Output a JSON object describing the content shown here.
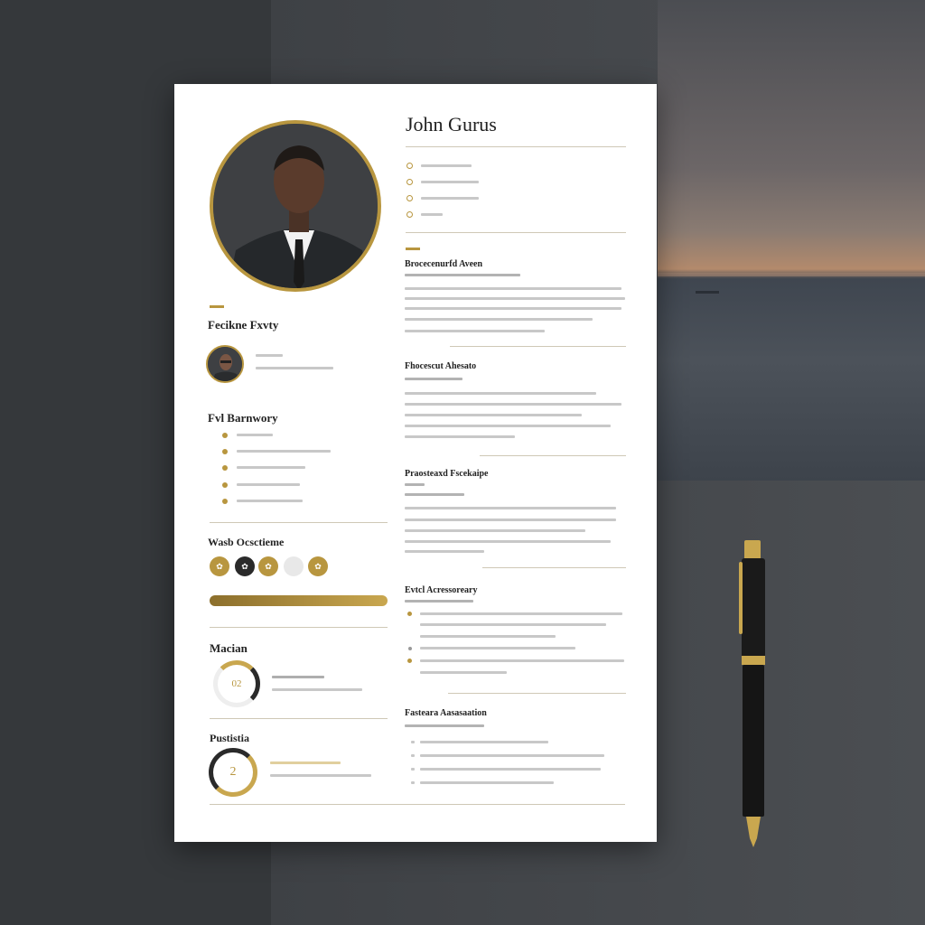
{
  "resume": {
    "name": "John Gurus",
    "left": {
      "section1_title": "Fecikne Fxvty",
      "section2_title": "Fvl Barnwory",
      "section3_title": "Wasb Ocsctieme",
      "section4_title": "Macian",
      "section5_title": "Pustistia",
      "ring1_value": "02",
      "ring2_value": "2"
    },
    "right": {
      "exp1_title": "Brocecenurfd Aveen",
      "exp2_title": "Fhocescut Ahesato",
      "exp3_title": "Praosteaxd Fscekaipe",
      "exp4_title": "Evtcl Acressoreary",
      "exp5_title": "Fasteara Aasasaation"
    }
  },
  "colors": {
    "accent": "#b8963f",
    "paper": "#ffffff",
    "background": "#3a3d40"
  }
}
